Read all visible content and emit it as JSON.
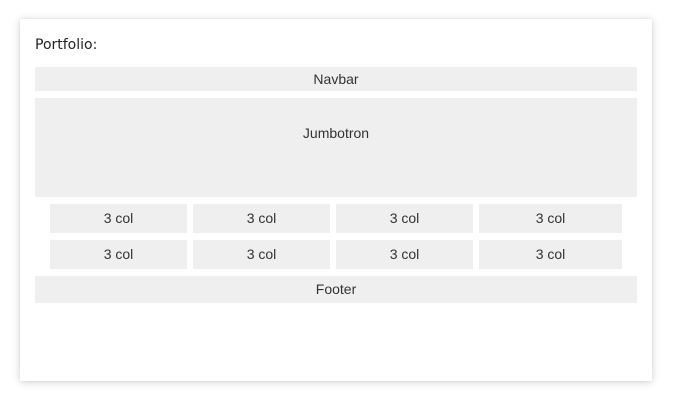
{
  "page": {
    "title": "Portfolio:"
  },
  "layout_blocks": {
    "navbar": "Navbar",
    "jumbotron": "Jumbotron",
    "rows": [
      [
        "3 col",
        "3 col",
        "3 col",
        "3 col"
      ],
      [
        "3 col",
        "3 col",
        "3 col",
        "3 col"
      ]
    ],
    "footer": "Footer"
  },
  "colors": {
    "block_background": "#efefef",
    "text": "#333333"
  }
}
